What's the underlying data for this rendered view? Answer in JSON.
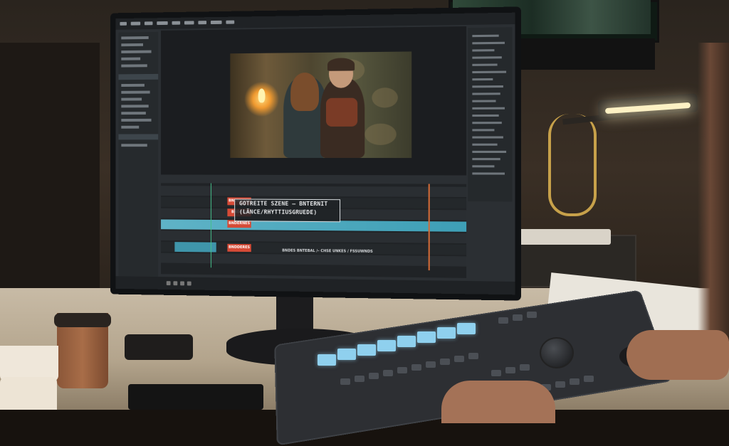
{
  "scene": "video editing workstation",
  "editor": {
    "title_card": {
      "line1": "GOTREITE SZENE – BNTERNIT",
      "line2": "(LÄNCE/RHYTTIUSGRUEDE)"
    },
    "timeline_caption": "BNDES BNTEBAL /– CHSE UNKES / FSSUWNDS",
    "clips": [
      {
        "track": 2,
        "label": "BNDERNES"
      },
      {
        "track": 3,
        "label": "BNDFES"
      },
      {
        "track": 4,
        "label": "BNDERNES"
      },
      {
        "track": 6,
        "label": "BNDDERES"
      }
    ],
    "blue_clip_label": "BNDSES"
  },
  "colors": {
    "clip_red": "#d64a36",
    "clip_blue": "#4fabc1",
    "playhead": "#d46b37",
    "pad_light": "#8fd0ee"
  }
}
